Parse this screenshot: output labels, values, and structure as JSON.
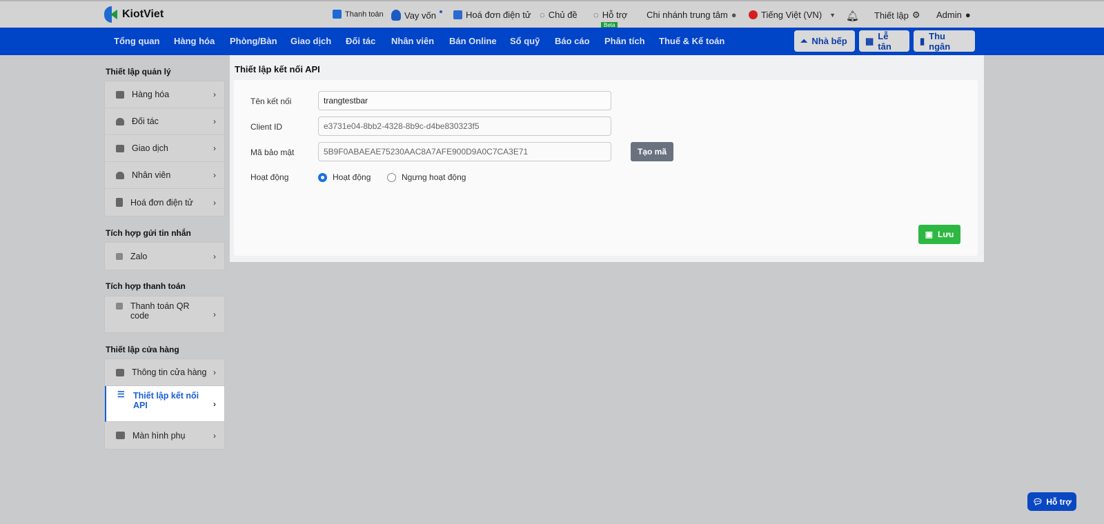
{
  "topbar": {
    "brand": "KiotViet",
    "links": [
      "Thanh toán",
      "Vay vốn",
      "Hoá đơn điện tử",
      "Chủ đề",
      "Hỗ trợ"
    ],
    "beta": "Beta",
    "branch": "Chi nhánh trung tâm",
    "language": "Tiếng Việt (VN)",
    "settings": "Thiết lập",
    "user": "Admin"
  },
  "nav": {
    "items": [
      "Tổng quan",
      "Hàng hóa",
      "Phòng/Bàn",
      "Giao dịch",
      "Đối tác",
      "Nhân viên",
      "Bán Online",
      "Sổ quỹ",
      "Báo cáo",
      "Phân tích",
      "Thuế & Kế toán"
    ],
    "buttons": [
      "Nhà bếp",
      "Lễ tân",
      "Thu ngân"
    ]
  },
  "sidebar": {
    "groups": [
      {
        "title": "Thiết lập quản lý",
        "items": [
          "Hàng hóa",
          "Đối tác",
          "Giao dịch",
          "Nhân viên",
          "Hoá đơn điện tử"
        ]
      },
      {
        "title": "Tích hợp gửi tin nhắn",
        "items": [
          "Zalo"
        ]
      },
      {
        "title": "Tích hợp thanh toán",
        "items": [
          "Thanh toán QR code"
        ]
      },
      {
        "title": "Thiết lập cửa hàng",
        "items": [
          "Thông tin cửa hàng",
          "Thiết lập kết nối API",
          "Màn hình phụ"
        ]
      }
    ]
  },
  "form": {
    "title": "Thiết lập kết nối API",
    "name_label": "Tên kết nối",
    "name_value": "trangtestbar",
    "client_label": "Client ID",
    "client_value": "e3731e04-8bb2-4328-8b9c-d4be830323f5",
    "secret_label": "Mã bảo mật",
    "secret_value": "5B9F0ABAEAE75230AAC8A7AFE900D9A0C7CA3E71",
    "generate": "Tạo mã",
    "status_label": "Hoạt động",
    "status_options": [
      "Hoạt động",
      "Ngưng hoạt động"
    ],
    "status_selected": "Hoạt động",
    "save": "Lưu"
  },
  "help": "Hỗ trợ"
}
